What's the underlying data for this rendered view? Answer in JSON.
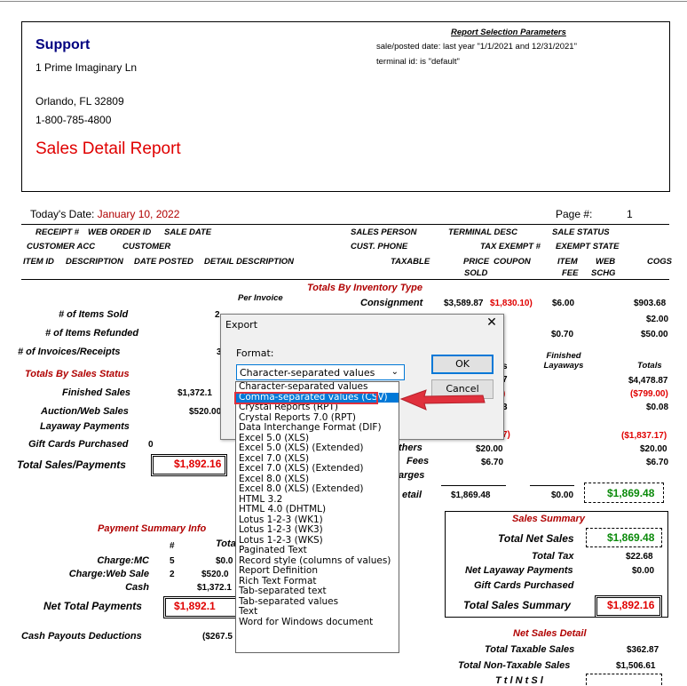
{
  "report": {
    "company": "Support",
    "address1": "1 Prime Imaginary Ln",
    "address2": "Orlando, FL 32809",
    "phone": "1-800-785-4800",
    "title": "Sales Detail Report",
    "params_title": "Report Selection Parameters",
    "param1": "sale/posted date: last year \"1/1/2021 and 12/31/2021\"",
    "param2": "terminal id: is \"default\"",
    "todays_date_label": "Today's Date:",
    "todays_date": "January 10, 2022",
    "page_label": "Page #:",
    "page_num": "1"
  },
  "headers": {
    "row1": [
      "RECEIPT #",
      "WEB ORDER ID",
      "SALE DATE",
      "SALES PERSON",
      "TERMINAL DESC",
      "SALE STATUS"
    ],
    "row2": [
      "CUSTOMER ACC",
      "CUSTOMER",
      "CUST. PHONE",
      "TAX EXEMPT #",
      "EXEMPT STATE"
    ],
    "row3": [
      "ITEM ID",
      "DESCRIPTION",
      "DATE POSTED",
      "DETAIL DESCRIPTION",
      "TAXABLE",
      "PRICE",
      "COUPON",
      "ITEM",
      "WEB",
      "COGS"
    ],
    "row3b": [
      "SOLD",
      "FEE",
      "SCHG"
    ]
  },
  "inventory": {
    "title": "Totals By Inventory Type",
    "per_invoice": "Per Invoice",
    "consignment_label": "Consignment",
    "consignment_price": "$3,589.87",
    "consignment_coupon": "$1,830.10)",
    "consignment_fee": "$6.00",
    "consignment_cogs": "$903.68",
    "r2_cogs": "$2.00",
    "r3_fee": "$0.70",
    "r3_cogs": "$50.00",
    "finished_layaways": "Finished Layaways",
    "totals": "Totals",
    "r5_total": "$4,478.87",
    "r6_total": "($799.00)",
    "r7_total": "$0.08",
    "r8_total": "($1,837.17)",
    "others_label": "thers",
    "others_val": "$20.00",
    "others_total": "$20.00",
    "fees_label": "Fees",
    "fees_val": "$6.70",
    "fees_total": "$6.70",
    "charges_label": "arges",
    "detail_label": "etail",
    "detail_val": "$1,869.48",
    "detail_fee": "$0.00",
    "detail_total": "$1,869.48",
    "partial_paren": ")",
    "partial_3": "3",
    "partial_7": "7)",
    "partial_s": "s",
    "partial_7b": "7"
  },
  "left": {
    "items_sold": "# of Items Sold",
    "items_sold_val": "2",
    "items_refunded": "# of Items Refunded",
    "invoices": "# of Invoices/Receipts",
    "invoices_val": "3",
    "status_title": "Totals By Sales Status",
    "finished": "Finished Sales",
    "finished_val": "$1,372.1",
    "auction": "Auction/Web Sales",
    "auction_val": "$520.00",
    "layaway": "Layaway Payments",
    "gift": "Gift Cards Purchased",
    "gift_val": "0",
    "total_sales": "Total Sales/Payments",
    "total_sales_val": "$1,892.16"
  },
  "payment": {
    "title": "Payment Summary Info",
    "hash": "#",
    "total_hdr": "Tota",
    "rows": [
      {
        "label": "Charge:MC",
        "count": "5",
        "val": "$0.0"
      },
      {
        "label": "Charge:Web Sale",
        "count": "2",
        "val": "$520.0"
      },
      {
        "label": "Cash",
        "count": "",
        "val": "$1,372.1"
      }
    ],
    "net_label": "Net Total Payments",
    "net_val": "$1,892.1",
    "payouts_label": "Cash Payouts Deductions",
    "payouts_val": "($267.5"
  },
  "sales_summary": {
    "title": "Sales Summary",
    "net_sales": "Total Net Sales",
    "net_sales_val": "$1,869.48",
    "tax": "Total Tax",
    "tax_val": "$22.68",
    "layaway": "Net Layaway Payments",
    "layaway_val": "$0.00",
    "gift": "Gift Cards Purchased",
    "total": "Total Sales Summary",
    "total_val": "$1,892.16"
  },
  "net_detail": {
    "title": "Net Sales Detail",
    "taxable": "Total Taxable Sales",
    "taxable_val": "$362.87",
    "nontaxable": "Total Non-Taxable Sales",
    "nontaxable_val": "$1,506.61",
    "partial": "T t l N t S l"
  },
  "dialog": {
    "title": "Export",
    "close": "✕",
    "format_label": "Format:",
    "selected": "Character-separated values",
    "ok": "OK",
    "cancel": "Cancel",
    "options": [
      "Character-separated values",
      "Comma-separated values (CSV)",
      "Crystal Reports (RPT)",
      "Crystal Reports 7.0 (RPT)",
      "Data Interchange Format (DIF)",
      "Excel 5.0 (XLS)",
      "Excel 5.0 (XLS) (Extended)",
      "Excel 7.0 (XLS)",
      "Excel 7.0 (XLS) (Extended)",
      "Excel 8.0 (XLS)",
      "Excel 8.0 (XLS) (Extended)",
      "HTML 3.2",
      "HTML 4.0 (DHTML)",
      "Lotus 1-2-3 (WK1)",
      "Lotus 1-2-3 (WK3)",
      "Lotus 1-2-3 (WKS)",
      "Paginated Text",
      "Record style (columns of values)",
      "Report Definition",
      "Rich Text Format",
      "Tab-separated text",
      "Tab-separated values",
      "Text",
      "Word for Windows document"
    ],
    "highlighted_index": 1
  },
  "colors": {
    "selection": "#0078d7",
    "annotation_red": "#e0303c",
    "title_red": "#e00000",
    "navy": "#000080"
  }
}
